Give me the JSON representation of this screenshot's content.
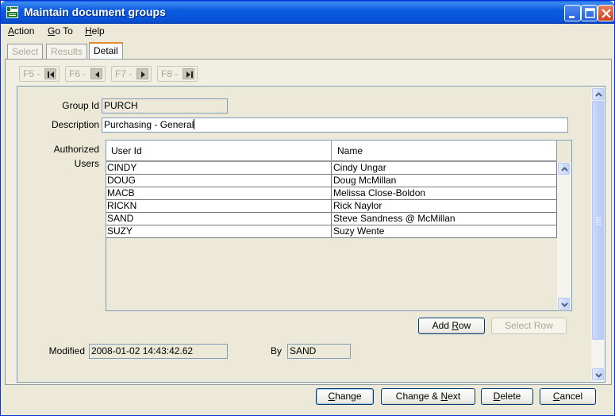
{
  "window": {
    "title": "Maintain document groups"
  },
  "menu": [
    {
      "pre": "",
      "key": "A",
      "post": "ction"
    },
    {
      "pre": "",
      "key": "G",
      "post": "o To"
    },
    {
      "pre": "",
      "key": "H",
      "post": "elp"
    }
  ],
  "tabs": [
    {
      "label": "Select",
      "active": false
    },
    {
      "label": "Results",
      "active": false
    },
    {
      "label": "Detail",
      "active": true
    }
  ],
  "nav": [
    {
      "label": "F5 -",
      "icon": "first-record-icon"
    },
    {
      "label": "F6 -",
      "icon": "previous-record-icon"
    },
    {
      "label": "F7 -",
      "icon": "next-record-icon"
    },
    {
      "label": "F8 -",
      "icon": "last-record-icon"
    }
  ],
  "form": {
    "group_id_label": "Group Id",
    "group_id_value": "PURCH",
    "description_label": "Description",
    "description_value": "Purchasing - General",
    "authorized_label_1": "Authorized",
    "authorized_label_2": "Users",
    "modified_label": "Modified",
    "modified_value": "2008-01-02 14:43:42.62",
    "by_label": "By",
    "by_value": "SAND"
  },
  "users_table": {
    "columns": [
      "User Id",
      "Name"
    ],
    "rows": [
      [
        "CINDY",
        "Cindy Ungar"
      ],
      [
        "DOUG",
        "Doug McMillan"
      ],
      [
        "MACB",
        "Melissa Close-Boldon"
      ],
      [
        "RICKN",
        "Rick Naylor"
      ],
      [
        "SAND",
        "Steve Sandness @ McMillan"
      ],
      [
        "SUZY",
        "Suzy Wente"
      ]
    ]
  },
  "table_buttons": {
    "add_row_pre": "Add ",
    "add_row_key": "R",
    "add_row_post": "ow",
    "select_row": "Select Row"
  },
  "footer_buttons": {
    "change_pre": "",
    "change_key": "C",
    "change_post": "hange",
    "change_next_pre": "Change & ",
    "change_next_key": "N",
    "change_next_post": "ext",
    "delete_pre": "",
    "delete_key": "D",
    "delete_post": "elete",
    "cancel_pre": "",
    "cancel_key": "C",
    "cancel_post": "ancel"
  },
  "colors": {
    "titlebar": "#0a5fd8",
    "window_bg": "#ece9d8",
    "active_tab_accent": "#e68b2c"
  }
}
